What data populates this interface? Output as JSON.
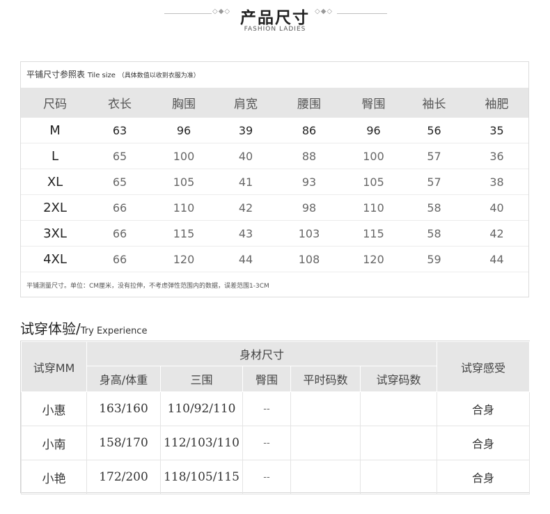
{
  "header": {
    "title": "产品尺寸",
    "subtitle": "FASHION LADIES",
    "ornament_left": "◇◆◇",
    "ornament_right": "◇◆◇"
  },
  "size_chart": {
    "caption_cn": "平铺尺寸参照表",
    "caption_en": "Tile size",
    "caption_note": "（具体数值以收到衣服为准）",
    "headers": [
      "尺码",
      "衣长",
      "胸围",
      "肩宽",
      "腰围",
      "臀围",
      "袖长",
      "袖肥"
    ],
    "rows": [
      [
        "M",
        "63",
        "96",
        "39",
        "86",
        "96",
        "56",
        "35"
      ],
      [
        "L",
        "65",
        "100",
        "40",
        "88",
        "100",
        "57",
        "36"
      ],
      [
        "XL",
        "65",
        "105",
        "41",
        "93",
        "105",
        "57",
        "38"
      ],
      [
        "2XL",
        "66",
        "110",
        "42",
        "98",
        "110",
        "58",
        "40"
      ],
      [
        "3XL",
        "66",
        "115",
        "43",
        "103",
        "115",
        "58",
        "42"
      ],
      [
        "4XL",
        "66",
        "120",
        "44",
        "108",
        "120",
        "59",
        "44"
      ]
    ],
    "footnote": "平铺测量尺寸。单位：CM厘米，没有拉伸，不考虑弹性范围内的数据，误差范围1-3CM"
  },
  "try_experience": {
    "title_cn": "试穿体验/",
    "title_en": "Try Experience",
    "col_model": "试穿MM",
    "col_body": "身材尺寸",
    "col_feel": "试穿感受",
    "sub_headers": [
      "身高/体重",
      "三围",
      "臀围",
      "平时码数",
      "试穿码数"
    ],
    "rows": [
      {
        "name": "小惠",
        "height_weight": "163/160",
        "measurements": "110/92/110",
        "hip": "--",
        "usual_size": "",
        "try_size": "",
        "feel": "合身"
      },
      {
        "name": "小南",
        "height_weight": "158/170",
        "measurements": "112/103/110",
        "hip": "--",
        "usual_size": "",
        "try_size": "",
        "feel": "合身"
      },
      {
        "name": "小艳",
        "height_weight": "172/200",
        "measurements": "118/105/115",
        "hip": "--",
        "usual_size": "",
        "try_size": "",
        "feel": "合身"
      }
    ]
  }
}
